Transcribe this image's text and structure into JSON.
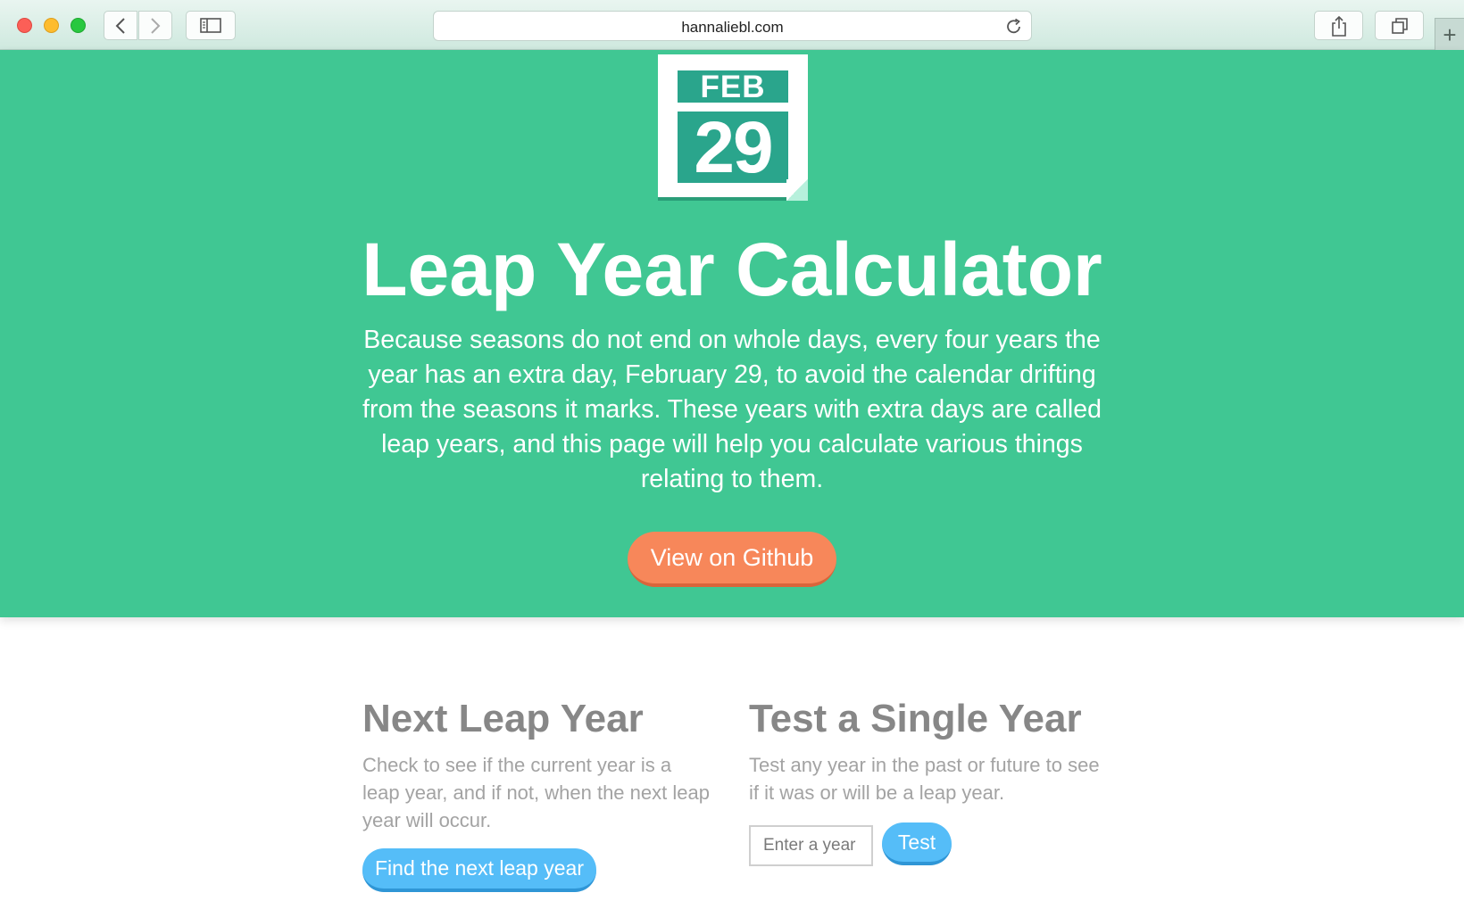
{
  "browser": {
    "address": "hannaliebl.com",
    "new_tab": "+"
  },
  "hero": {
    "calendar_month": "FEB",
    "calendar_day": "29",
    "title": "Leap Year Calculator",
    "description": "Because seasons do not end on whole days, every four years the year has an extra day, February 29, to avoid the calendar drifting from the seasons it marks. These years with extra days are called leap years, and this page will help you calculate various things relating to them.",
    "github_button": "View on Github"
  },
  "next_leap": {
    "title": "Next Leap Year",
    "description": "Check to see if the current year is a leap year, and if not, when the next leap year will occur.",
    "button": "Find the next leap year"
  },
  "single_year": {
    "title": "Test a Single Year",
    "description": "Test any year in the past or future to see if it was or will be a leap year.",
    "input_placeholder": "Enter a year",
    "button": "Test"
  },
  "colors": {
    "hero_bg": "#40c793",
    "orange_button": "#f7875a",
    "blue_button": "#55bdf8",
    "calendar_teal": "#2aa58c"
  }
}
